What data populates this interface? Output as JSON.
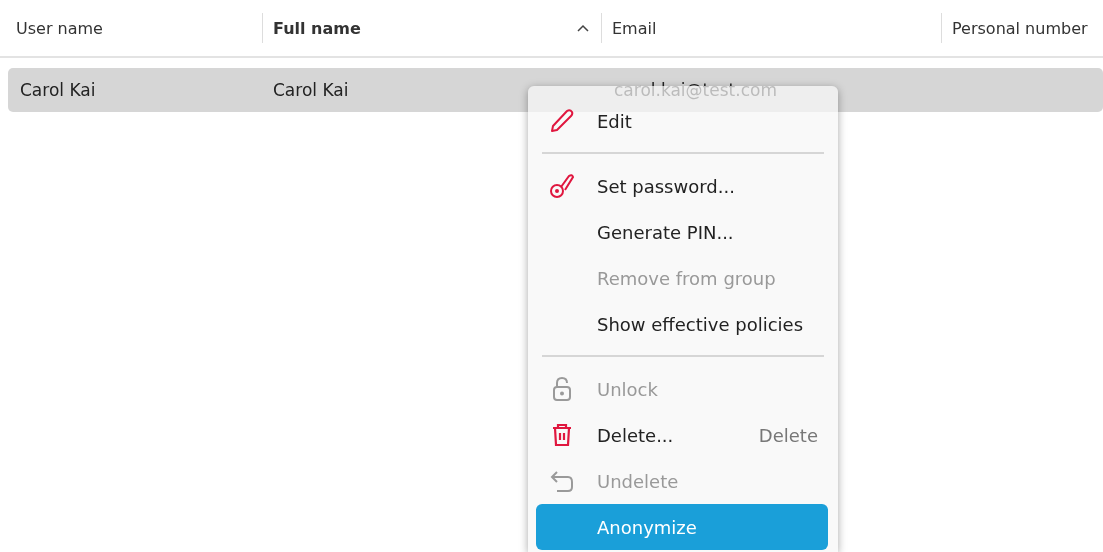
{
  "table": {
    "columns": [
      {
        "label": "User name",
        "sorted": false
      },
      {
        "label": "Full name",
        "sorted": true
      },
      {
        "label": "Email",
        "sorted": false
      },
      {
        "label": "Personal number",
        "sorted": false
      }
    ],
    "rows": [
      {
        "selected": true,
        "cells": [
          "Carol Kai",
          "Carol Kai",
          "carol.kai@test.com"
        ]
      }
    ]
  },
  "context_menu": {
    "items": [
      {
        "kind": "item",
        "label": "Edit",
        "disabled": false,
        "selected": false
      },
      {
        "kind": "separator"
      },
      {
        "kind": "item",
        "label": "Set password...",
        "disabled": false,
        "selected": false
      },
      {
        "kind": "item",
        "label": "Generate PIN...",
        "disabled": false,
        "selected": false
      },
      {
        "kind": "item",
        "label": "Remove from group",
        "disabled": true,
        "selected": false
      },
      {
        "kind": "item",
        "label": "Show effective policies",
        "disabled": false,
        "selected": false
      },
      {
        "kind": "separator"
      },
      {
        "kind": "item",
        "label": "Unlock",
        "disabled": true,
        "selected": false
      },
      {
        "kind": "item",
        "label": "Delete...",
        "shortcut": "Delete",
        "disabled": false,
        "selected": false
      },
      {
        "kind": "item",
        "label": "Undelete",
        "disabled": true,
        "selected": false
      },
      {
        "kind": "item",
        "label": "Anonymize",
        "disabled": false,
        "selected": true
      }
    ]
  }
}
